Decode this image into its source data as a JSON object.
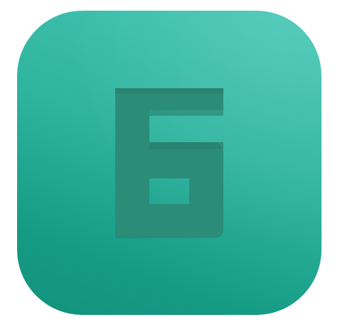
{
  "app_icon": {
    "glyph_icon": "cyrillic-be-letter-icon",
    "colors": {
      "gradient_light": "#45c7b6",
      "gradient_mid": "#2fb49f",
      "gradient_dark": "#12927d",
      "glyph_fill": "#2b8c78",
      "glyph_shadow": "#267b69"
    }
  }
}
